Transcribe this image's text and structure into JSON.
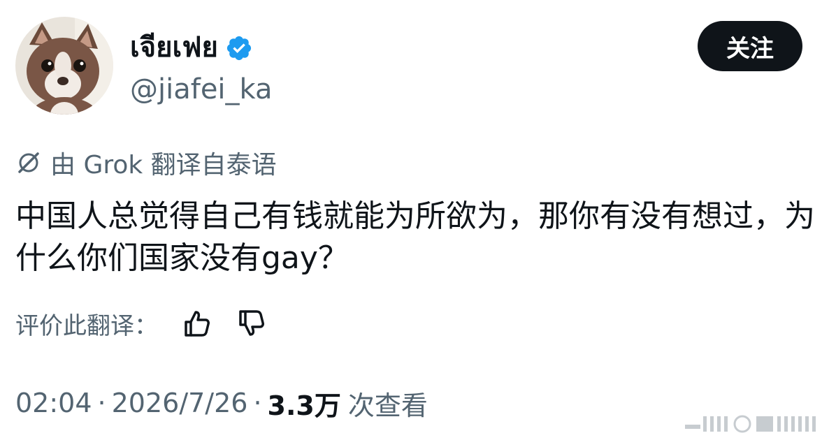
{
  "author": {
    "display_name": "เจียเฟย",
    "handle": "@jiafei_ka",
    "verified": true,
    "avatar": "chihuahua-dog-photo"
  },
  "header": {
    "follow_label": "关注"
  },
  "translation": {
    "icon": "grok-icon",
    "label": "由 Grok 翻译自泰语"
  },
  "tweet": {
    "text": "中国人总觉得自己有钱就能为所欲为，那你有没有想过，为什么你们国家没有gay？"
  },
  "rating": {
    "label": "评价此翻译：",
    "thumbs_up_icon": "thumbs-up-icon",
    "thumbs_down_icon": "thumbs-down-icon"
  },
  "meta": {
    "time": "02:04",
    "separator": "·",
    "date": "2026/7/26",
    "views_count": "3.3万",
    "views_label": "次查看"
  },
  "colors": {
    "text_primary": "#0f1419",
    "text_secondary": "#536471",
    "verified_blue": "#1d9bf0",
    "button_bg": "#0f1419"
  }
}
